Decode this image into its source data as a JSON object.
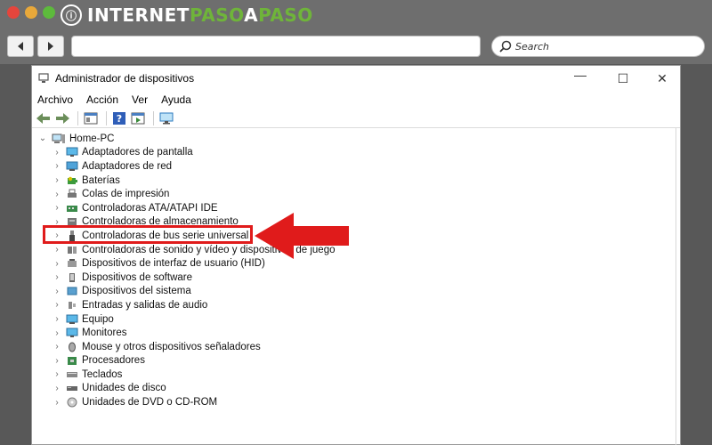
{
  "browser": {
    "logo": {
      "part1": "INTERNET",
      "part2": "PASO",
      "part3": "A",
      "part4": "PASO"
    },
    "search_placeholder": "Search"
  },
  "window": {
    "title": "Administrador de dispositivos",
    "controls": {
      "minimize": "—",
      "maximize": "☐",
      "close": "✕"
    }
  },
  "menu": [
    "Archivo",
    "Acción",
    "Ver",
    "Ayuda"
  ],
  "tree": {
    "root": "Home-PC",
    "items": [
      {
        "label": "Adaptadores de pantalla",
        "icon": "monitor-icon"
      },
      {
        "label": "Adaptadores de red",
        "icon": "network-icon"
      },
      {
        "label": "Baterías",
        "icon": "battery-icon"
      },
      {
        "label": "Colas de impresión",
        "icon": "printer-icon"
      },
      {
        "label": "Controladoras ATA/ATAPI IDE",
        "icon": "ide-icon"
      },
      {
        "label": "Controladoras de almacenamiento",
        "icon": "storage-icon"
      },
      {
        "label": "Controladoras de bus serie universal",
        "icon": "usb-icon"
      },
      {
        "label": "Controladoras de sonido y vídeo y dispositivos de juego",
        "icon": "speaker-icon"
      },
      {
        "label": "Dispositivos de interfaz de usuario (HID)",
        "icon": "hid-icon"
      },
      {
        "label": "Dispositivos de software",
        "icon": "software-icon"
      },
      {
        "label": "Dispositivos del sistema",
        "icon": "system-icon"
      },
      {
        "label": "Entradas y salidas de audio",
        "icon": "audio-icon"
      },
      {
        "label": "Equipo",
        "icon": "computer-icon"
      },
      {
        "label": "Monitores",
        "icon": "monitor-icon"
      },
      {
        "label": "Mouse y otros dispositivos señaladores",
        "icon": "mouse-icon"
      },
      {
        "label": "Procesadores",
        "icon": "cpu-icon"
      },
      {
        "label": "Teclados",
        "icon": "keyboard-icon"
      },
      {
        "label": "Unidades de disco",
        "icon": "disk-icon"
      },
      {
        "label": "Unidades de DVD o CD-ROM",
        "icon": "dvd-icon"
      }
    ]
  },
  "colors": {
    "highlight": "#e01b1b",
    "logo_green": "#6fb43a"
  }
}
